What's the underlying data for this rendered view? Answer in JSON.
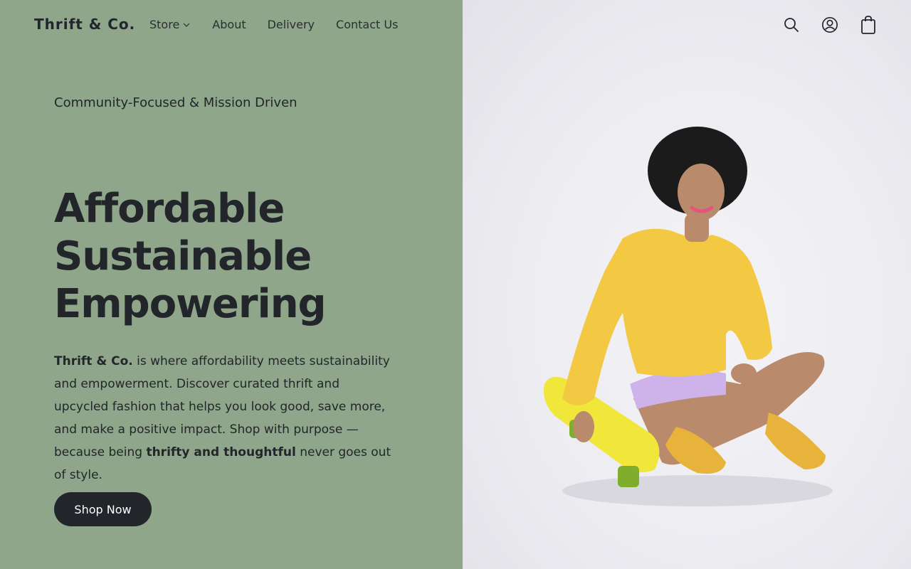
{
  "colors": {
    "panel_green": "#8fa68b",
    "text_dark": "#22262a",
    "button_bg": "#22262a",
    "button_text": "#ffffff",
    "sweater_yellow": "#f3c843",
    "skateboard_yellow": "#f1e63a"
  },
  "header": {
    "logo": "Thrift & Co.",
    "nav": [
      {
        "label": "Store",
        "has_dropdown": true
      },
      {
        "label": "About"
      },
      {
        "label": "Delivery"
      },
      {
        "label": "Contact Us"
      }
    ],
    "icons": [
      "search-icon",
      "account-icon",
      "shopping-bag-icon"
    ]
  },
  "hero": {
    "tagline": "Community-Focused & Mission Driven",
    "headline": [
      "Affordable",
      "Sustainable",
      "Empowering"
    ],
    "description": {
      "brand": "Thrift & Co.",
      "part1": " is where affordability meets sustainability and empowerment. Discover curated thrift and upcycled fashion that helps you look good, save more, and make a positive impact. Shop with purpose — because being ",
      "emphasis": "thrifty and thoughtful",
      "part2": " never goes out of style."
    },
    "cta_label": "Shop Now"
  }
}
